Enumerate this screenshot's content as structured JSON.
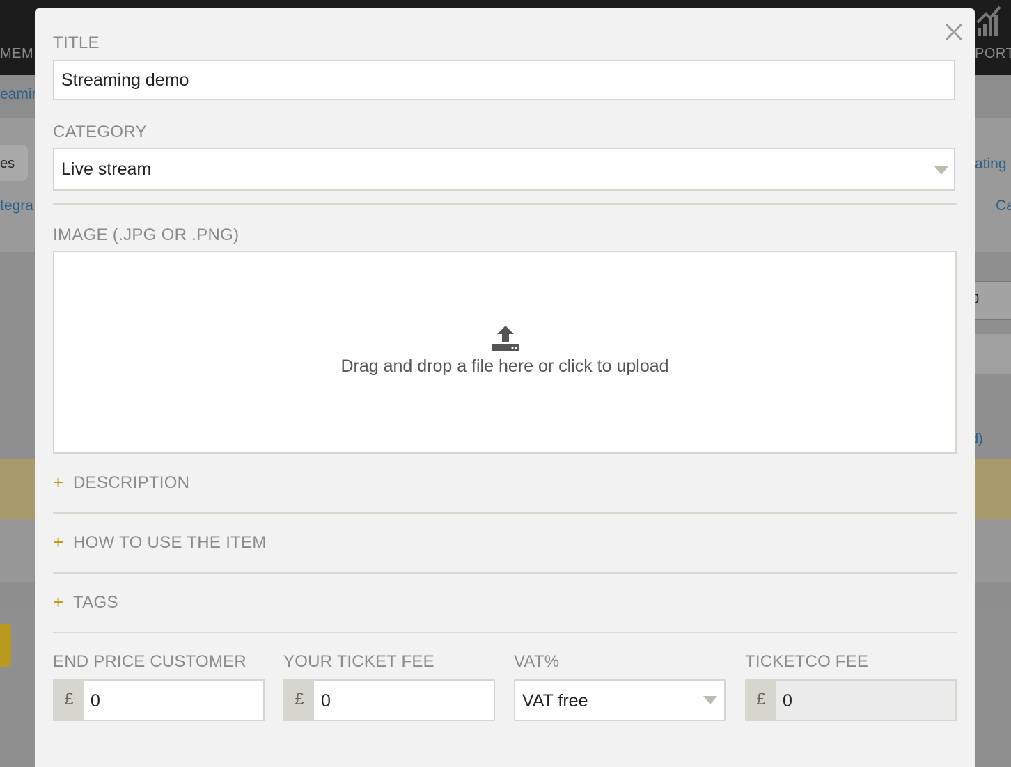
{
  "background": {
    "topbar": {
      "left_label": "MEM",
      "right_label": "PORT"
    },
    "subbar": {
      "link": "eamir"
    },
    "tab_partial": "es",
    "link_left": "tegra",
    "link_right_top": "ating",
    "link_right": "Ca",
    "right_field_value": "0",
    "right_link": "d)"
  },
  "modal": {
    "title": {
      "label": "TITLE",
      "value": "Streaming demo"
    },
    "category": {
      "label": "CATEGORY",
      "value": "Live stream"
    },
    "image": {
      "label": "IMAGE (.JPG OR .PNG)",
      "dropzone_text": "Drag and drop a file here or click to upload"
    },
    "sections": [
      {
        "label": "DESCRIPTION"
      },
      {
        "label": "HOW TO USE THE ITEM"
      },
      {
        "label": "TAGS"
      }
    ],
    "pricing": {
      "end_price": {
        "label": "END PRICE CUSTOMER",
        "currency": "£",
        "value": "0"
      },
      "ticket_fee": {
        "label": "YOUR TICKET FEE",
        "currency": "£",
        "value": "0"
      },
      "vat": {
        "label": "VAT%",
        "value": "VAT free"
      },
      "ticketco_fee": {
        "label": "TICKETCO FEE",
        "currency": "£",
        "value": "0"
      }
    },
    "accent_color": "#b8961b"
  }
}
